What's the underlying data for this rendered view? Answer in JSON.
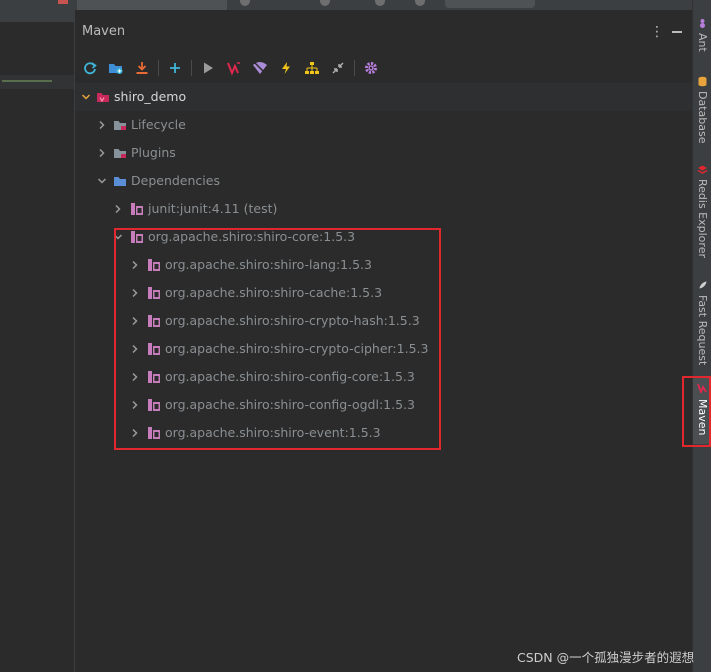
{
  "window": {
    "title": "Maven"
  },
  "toolbar": {
    "buttons": [
      {
        "name": "reload-all-icon"
      },
      {
        "name": "add-maven-project-icon"
      },
      {
        "name": "download-sources-icon"
      },
      {
        "name": "add-icon"
      },
      {
        "name": "run-icon"
      },
      {
        "name": "execute-goal-icon"
      },
      {
        "name": "toggle-offline-icon"
      },
      {
        "name": "skip-tests-icon"
      },
      {
        "name": "show-dependencies-icon"
      },
      {
        "name": "collapse-all-icon"
      },
      {
        "name": "settings-icon"
      }
    ]
  },
  "tree": {
    "root": "shiro_demo",
    "lifecycle": "Lifecycle",
    "plugins": "Plugins",
    "dependencies": "Dependencies",
    "deps": {
      "junit": "junit:junit:4.11 (test)",
      "shiro_core": "org.apache.shiro:shiro-core:1.5.3",
      "children": [
        "org.apache.shiro:shiro-lang:1.5.3",
        "org.apache.shiro:shiro-cache:1.5.3",
        "org.apache.shiro:shiro-crypto-hash:1.5.3",
        "org.apache.shiro:shiro-crypto-cipher:1.5.3",
        "org.apache.shiro:shiro-config-core:1.5.3",
        "org.apache.shiro:shiro-config-ogdl:1.5.3",
        "org.apache.shiro:shiro-event:1.5.3"
      ]
    }
  },
  "side_tabs": {
    "ant": "Ant",
    "database": "Database",
    "redis": "Redis Explorer",
    "fast_request": "Fast Request",
    "maven": "Maven"
  },
  "watermark": "CSDN @一个孤独漫步者的遐想",
  "colors": {
    "highlight_border": "#e0282e",
    "maven_accent": "#c72a5a",
    "dependency_icon": "#c77dbb",
    "folder_icon": "#87939a",
    "dependencies_folder": "#5a8fd6"
  }
}
